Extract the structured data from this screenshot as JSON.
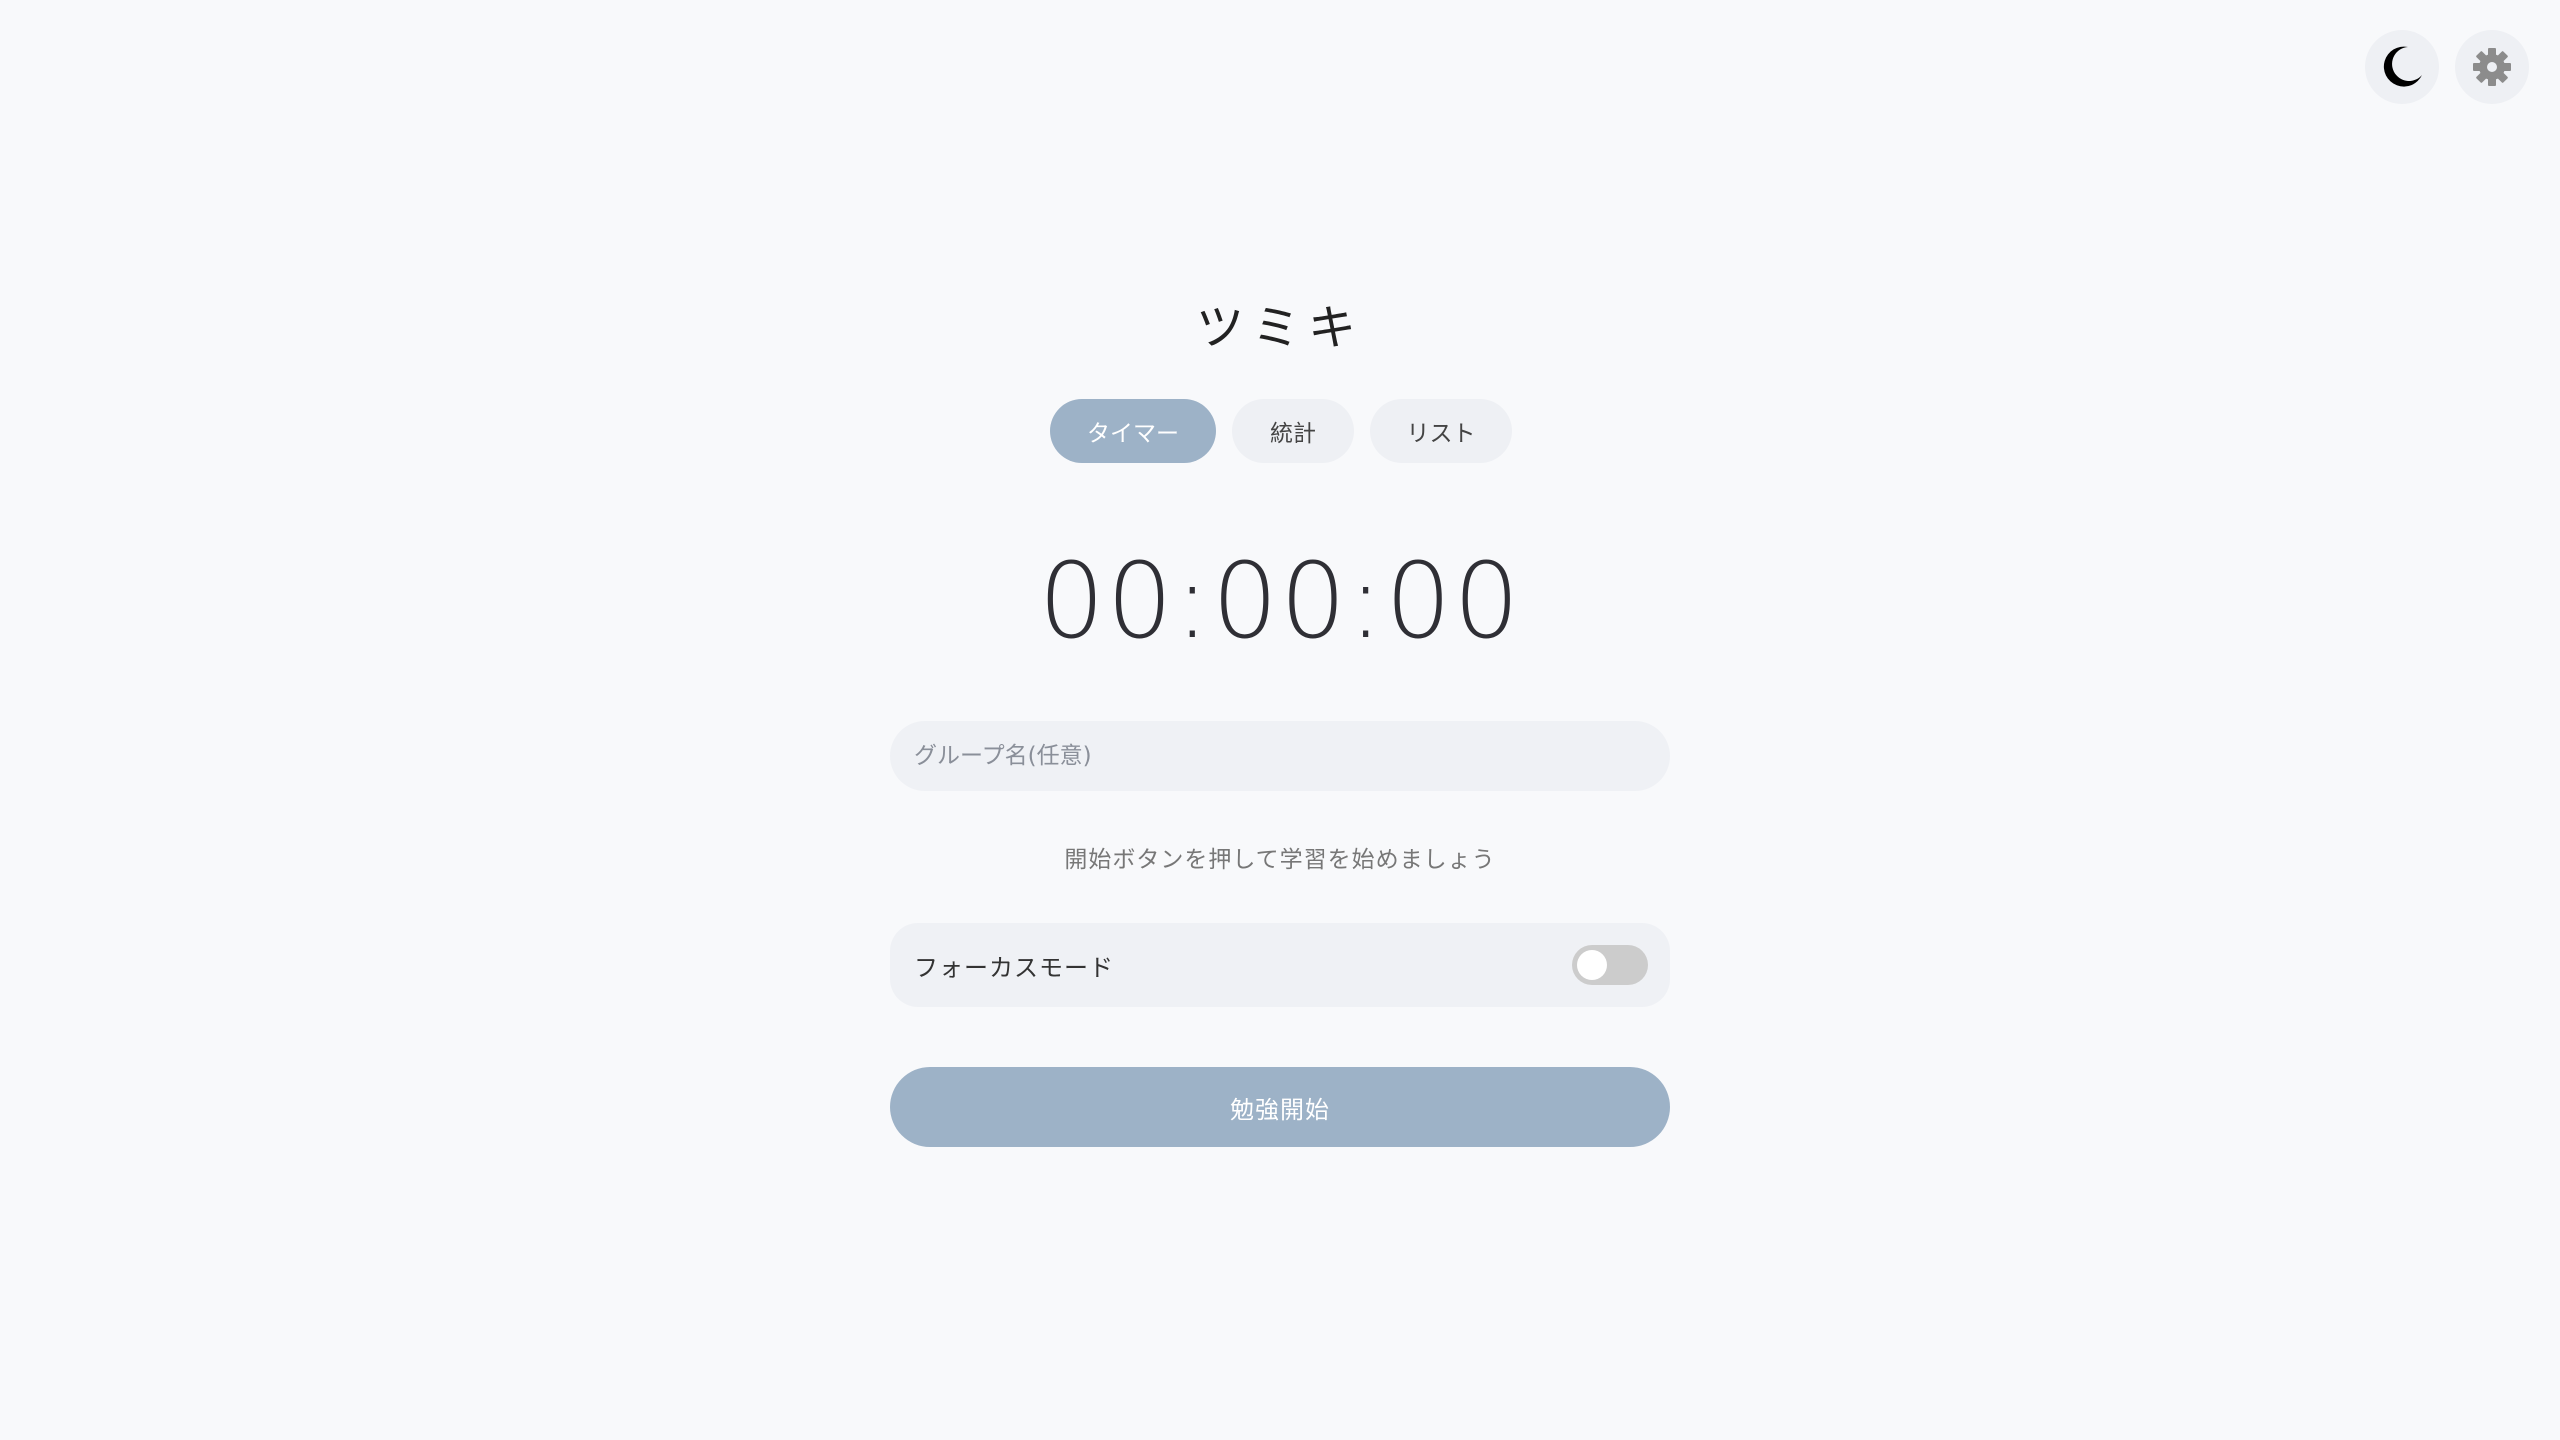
{
  "app": {
    "title": "ツミキ"
  },
  "top_right": {
    "theme_icon": "moon-icon",
    "settings_icon": "gear-icon"
  },
  "tabs": [
    {
      "label": "タイマー",
      "active": true
    },
    {
      "label": "統計",
      "active": false
    },
    {
      "label": "リスト",
      "active": false
    }
  ],
  "timer": {
    "display": "00:00:00"
  },
  "group_input": {
    "placeholder": "グループ名(任意)",
    "value": ""
  },
  "hint": "開始ボタンを押して学習を始めましょう",
  "focus_mode": {
    "label": "フォーカスモード",
    "enabled": false
  },
  "start_button": {
    "label": "勉強開始"
  },
  "colors": {
    "accent": "#9db2c7",
    "background": "#f8f9fb",
    "surface": "#eff1f5"
  }
}
